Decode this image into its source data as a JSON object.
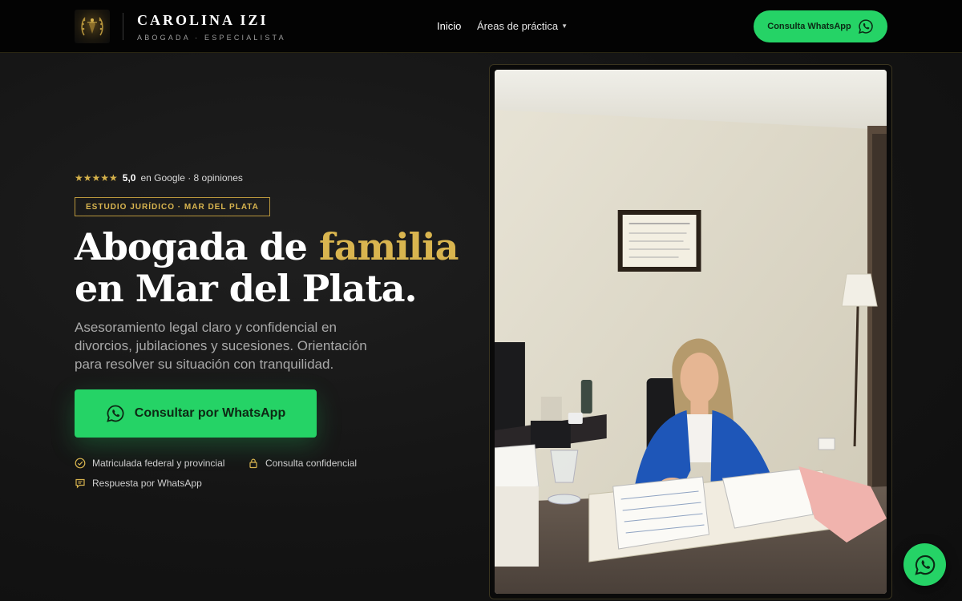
{
  "header": {
    "brand_name": "CAROLINA IZI",
    "brand_sub": "ABOGADA · ESPECIALISTA",
    "nav": [
      {
        "label": "Inicio"
      },
      {
        "label": "Áreas de práctica"
      }
    ],
    "cta_label": "Consulta WhatsApp"
  },
  "hero": {
    "stars": "★★★★★",
    "rating_score": "5,0",
    "rating_text": "en Google · 8 opiniones",
    "tag": "ESTUDIO JURÍDICO · MAR DEL PLATA",
    "headline_part1": "Abogada de ",
    "headline_accent": "familia",
    "headline_part2": "en Mar del Plata.",
    "lead": "Asesoramiento legal claro y confidencial en divorcios, jubilaciones y sucesiones. Orientación para resolver su situación con tranquilidad.",
    "cta_label": "Consultar por WhatsApp",
    "features": [
      {
        "label": "Matriculada federal y provincial",
        "icon": "check-circle-icon"
      },
      {
        "label": "Consulta confidencial",
        "icon": "lock-icon"
      },
      {
        "label": "Respuesta por WhatsApp",
        "icon": "chat-icon"
      }
    ]
  },
  "colors": {
    "accent_gold": "#d9b54f",
    "whatsapp_green": "#25d366",
    "background": "#141414"
  }
}
